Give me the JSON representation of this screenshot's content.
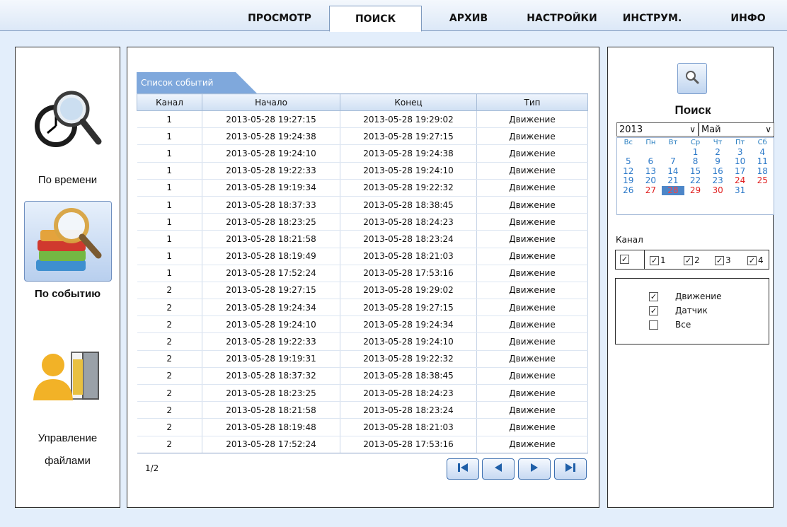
{
  "menu": [
    "ПРОСМОТР",
    "ПОИСК",
    "АРХИВ",
    "НАСТРОЙКИ",
    "ИНСТРУМ.",
    "ИНФО"
  ],
  "menu_active": "ПОИСК",
  "modes": {
    "by_time": "По времени",
    "by_event": "По событию",
    "file_mgmt_line1": "Управление",
    "file_mgmt_line2": "файлами"
  },
  "events": {
    "tab_label": "Список событий",
    "columns": [
      "Канал",
      "Начало",
      "Конец",
      "Тип"
    ],
    "rows": [
      [
        "1",
        "2013-05-28 19:27:15",
        "2013-05-28 19:29:02",
        "Движение"
      ],
      [
        "1",
        "2013-05-28 19:24:38",
        "2013-05-28 19:27:15",
        "Движение"
      ],
      [
        "1",
        "2013-05-28 19:24:10",
        "2013-05-28 19:24:38",
        "Движение"
      ],
      [
        "1",
        "2013-05-28 19:22:33",
        "2013-05-28 19:24:10",
        "Движение"
      ],
      [
        "1",
        "2013-05-28 19:19:34",
        "2013-05-28 19:22:32",
        "Движение"
      ],
      [
        "1",
        "2013-05-28 18:37:33",
        "2013-05-28 18:38:45",
        "Движение"
      ],
      [
        "1",
        "2013-05-28 18:23:25",
        "2013-05-28 18:24:23",
        "Движение"
      ],
      [
        "1",
        "2013-05-28 18:21:58",
        "2013-05-28 18:23:24",
        "Движение"
      ],
      [
        "1",
        "2013-05-28 18:19:49",
        "2013-05-28 18:21:03",
        "Движение"
      ],
      [
        "1",
        "2013-05-28 17:52:24",
        "2013-05-28 17:53:16",
        "Движение"
      ],
      [
        "2",
        "2013-05-28 19:27:15",
        "2013-05-28 19:29:02",
        "Движение"
      ],
      [
        "2",
        "2013-05-28 19:24:34",
        "2013-05-28 19:27:15",
        "Движение"
      ],
      [
        "2",
        "2013-05-28 19:24:10",
        "2013-05-28 19:24:34",
        "Движение"
      ],
      [
        "2",
        "2013-05-28 19:22:33",
        "2013-05-28 19:24:10",
        "Движение"
      ],
      [
        "2",
        "2013-05-28 19:19:31",
        "2013-05-28 19:22:32",
        "Движение"
      ],
      [
        "2",
        "2013-05-28 18:37:32",
        "2013-05-28 18:38:45",
        "Движение"
      ],
      [
        "2",
        "2013-05-28 18:23:25",
        "2013-05-28 18:24:23",
        "Движение"
      ],
      [
        "2",
        "2013-05-28 18:21:58",
        "2013-05-28 18:23:24",
        "Движение"
      ],
      [
        "2",
        "2013-05-28 18:19:48",
        "2013-05-28 18:21:03",
        "Движение"
      ],
      [
        "2",
        "2013-05-28 17:52:24",
        "2013-05-28 17:53:16",
        "Движение"
      ]
    ],
    "page": "1/2"
  },
  "search": {
    "title": "Поиск",
    "year": "2013",
    "month": "Май",
    "weekdays": [
      "Вс",
      "Пн",
      "Вт",
      "Ср",
      "Чт",
      "Пт",
      "Сб"
    ],
    "calendar_rows": [
      [
        "",
        "",
        "",
        "1",
        "2",
        "3",
        "4"
      ],
      [
        "5",
        "6",
        "7",
        "8",
        "9",
        "10",
        "11"
      ],
      [
        "12",
        "13",
        "14",
        "15",
        "16",
        "17",
        "18"
      ],
      [
        "19",
        "20",
        "21",
        "22",
        "23",
        "24",
        "25"
      ],
      [
        "26",
        "27",
        "28",
        "29",
        "30",
        "31",
        ""
      ]
    ],
    "selected_day": "28",
    "highlighted_days": [
      "24",
      "25",
      "27",
      "29",
      "30"
    ],
    "channel_label": "Канал",
    "channels": [
      "1",
      "2",
      "3",
      "4"
    ],
    "types": [
      "Движение",
      "Датчик",
      "Все"
    ],
    "types_checked": [
      true,
      true,
      false
    ]
  },
  "colors": {
    "background": "#e3eefb",
    "accent": "#7fa8dc",
    "day_link": "#2a78c8",
    "day_alert": "#e02020"
  }
}
